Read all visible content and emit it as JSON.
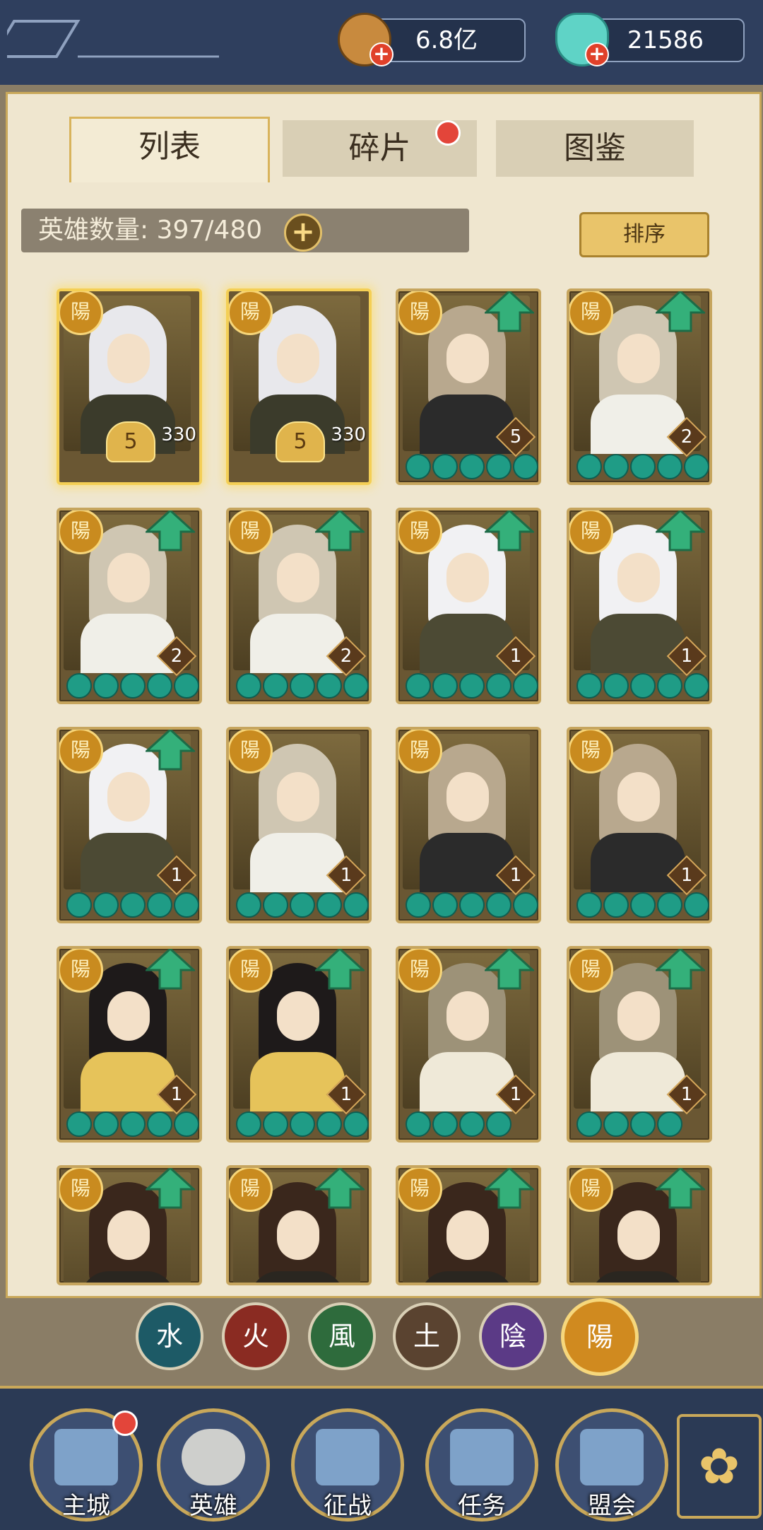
{
  "header": {
    "gold_value": "6.8亿",
    "gem_value": "21586"
  },
  "tabs": [
    {
      "label": "列表",
      "active": true
    },
    {
      "label": "碎片",
      "active": false,
      "badge": true
    },
    {
      "label": "图鉴",
      "active": false
    }
  ],
  "hero_count": {
    "label": "英雄数量: 397/480"
  },
  "sort_button": {
    "label": "排序"
  },
  "cards": [
    {
      "faction": "陽",
      "level": "5",
      "power": "330",
      "gold": true,
      "upgrade": false,
      "stars": 0,
      "hair": "#e8e8ec",
      "body": "#3b3b2b"
    },
    {
      "faction": "陽",
      "level": "5",
      "power": "330",
      "gold": true,
      "upgrade": false,
      "stars": 0,
      "hair": "#e8e8ec",
      "body": "#3b3b2b"
    },
    {
      "faction": "陽",
      "level": "5",
      "gold": false,
      "upgrade": true,
      "stars": 5,
      "hair": "#b8a88e",
      "body": "#2b2b2b"
    },
    {
      "faction": "陽",
      "level": "2",
      "gold": false,
      "upgrade": true,
      "stars": 5,
      "hair": "#cfc6b2",
      "body": "#f0efe8"
    },
    {
      "faction": "陽",
      "level": "2",
      "gold": false,
      "upgrade": true,
      "stars": 5,
      "hair": "#cfc6b2",
      "body": "#f0efe8"
    },
    {
      "faction": "陽",
      "level": "2",
      "gold": false,
      "upgrade": true,
      "stars": 5,
      "hair": "#cfc6b2",
      "body": "#f0efe8"
    },
    {
      "faction": "陽",
      "level": "1",
      "gold": false,
      "upgrade": true,
      "stars": 5,
      "hair": "#f1f1f3",
      "body": "#4c4a34"
    },
    {
      "faction": "陽",
      "level": "1",
      "gold": false,
      "upgrade": true,
      "stars": 5,
      "hair": "#f1f1f3",
      "body": "#4c4a34"
    },
    {
      "faction": "陽",
      "level": "1",
      "gold": false,
      "upgrade": true,
      "stars": 5,
      "hair": "#f1f1f3",
      "body": "#4c4a34"
    },
    {
      "faction": "陽",
      "level": "1",
      "gold": false,
      "upgrade": false,
      "stars": 5,
      "hair": "#cfc6b2",
      "body": "#f0efe8"
    },
    {
      "faction": "陽",
      "level": "1",
      "gold": false,
      "upgrade": false,
      "stars": 5,
      "hair": "#b8a88e",
      "body": "#2b2b2b"
    },
    {
      "faction": "陽",
      "level": "1",
      "gold": false,
      "upgrade": false,
      "stars": 5,
      "hair": "#b8a88e",
      "body": "#2b2b2b"
    },
    {
      "faction": "陽",
      "level": "1",
      "gold": false,
      "upgrade": true,
      "stars": 5,
      "hair": "#1e1a1a",
      "body": "#e6c35a"
    },
    {
      "faction": "陽",
      "level": "1",
      "gold": false,
      "upgrade": true,
      "stars": 5,
      "hair": "#1e1a1a",
      "body": "#e6c35a"
    },
    {
      "faction": "陽",
      "level": "1",
      "gold": false,
      "upgrade": true,
      "stars": 4,
      "hair": "#9d9278",
      "body": "#efe9d8"
    },
    {
      "faction": "陽",
      "level": "1",
      "gold": false,
      "upgrade": true,
      "stars": 4,
      "hair": "#9d9278",
      "body": "#efe9d8"
    },
    {
      "faction": "陽",
      "level": "",
      "gold": false,
      "upgrade": true,
      "stars": 0,
      "hair": "#3a271c",
      "body": "#2a2620"
    },
    {
      "faction": "陽",
      "level": "",
      "gold": false,
      "upgrade": true,
      "stars": 0,
      "hair": "#3a271c",
      "body": "#2a2620"
    },
    {
      "faction": "陽",
      "level": "",
      "gold": false,
      "upgrade": true,
      "stars": 0,
      "hair": "#3a271c",
      "body": "#2a2620"
    },
    {
      "faction": "陽",
      "level": "",
      "gold": false,
      "upgrade": true,
      "stars": 0,
      "hair": "#3a271c",
      "body": "#2a2620"
    }
  ],
  "elements": [
    {
      "label": "水",
      "color": "#1d5a66"
    },
    {
      "label": "火",
      "color": "#8a2b22"
    },
    {
      "label": "風",
      "color": "#2e6b3c"
    },
    {
      "label": "土",
      "color": "#5a4330"
    },
    {
      "label": "陰",
      "color": "#5b3a86"
    },
    {
      "label": "陽",
      "color": "#d08a1f"
    }
  ],
  "bottom_nav": [
    {
      "label": "主城",
      "badge": true
    },
    {
      "label": "英雄",
      "badge": false
    },
    {
      "label": "征战",
      "badge": false
    },
    {
      "label": "任务",
      "badge": false
    },
    {
      "label": "盟会",
      "badge": false
    }
  ]
}
